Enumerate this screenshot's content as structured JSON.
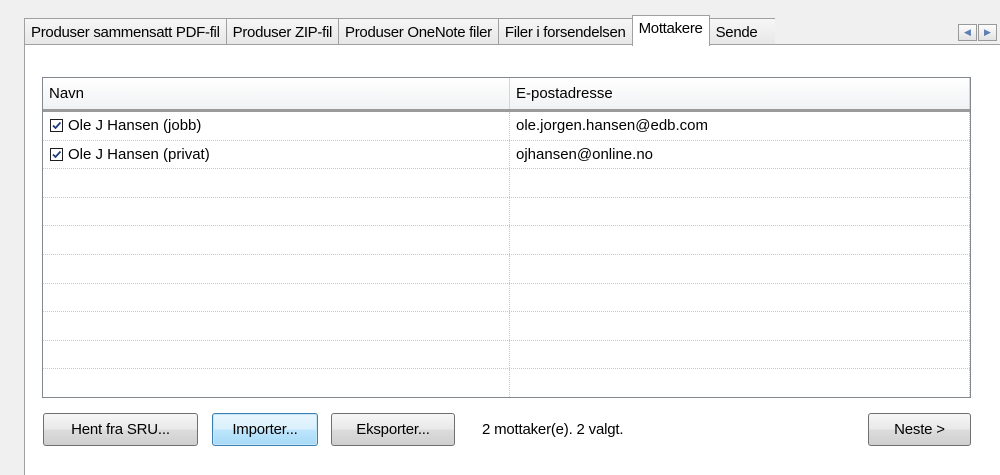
{
  "tabs": [
    {
      "label": "Produser sammensatt PDF-fil"
    },
    {
      "label": "Produser ZIP-fil"
    },
    {
      "label": "Produser OneNote filer"
    },
    {
      "label": "Filer i forsendelsen"
    },
    {
      "label": "Mottakere"
    },
    {
      "label": "Sende"
    }
  ],
  "tab_scroll": {
    "left": "◀",
    "right": "▶"
  },
  "recipients": {
    "columns": [
      "Navn",
      "E-postadresse"
    ],
    "rows": [
      {
        "name": "Ole J Hansen (jobb)",
        "email": "ole.jorgen.hansen@edb.com",
        "checked": true
      },
      {
        "name": "Ole J Hansen (privat)",
        "email": "ojhansen@online.no",
        "checked": true
      }
    ]
  },
  "buttons": {
    "fetch": "Hent fra SRU...",
    "import": "Importer...",
    "export": "Eksporter...",
    "next": "Neste >"
  },
  "status_text": "2 mottaker(e).  2 valgt."
}
